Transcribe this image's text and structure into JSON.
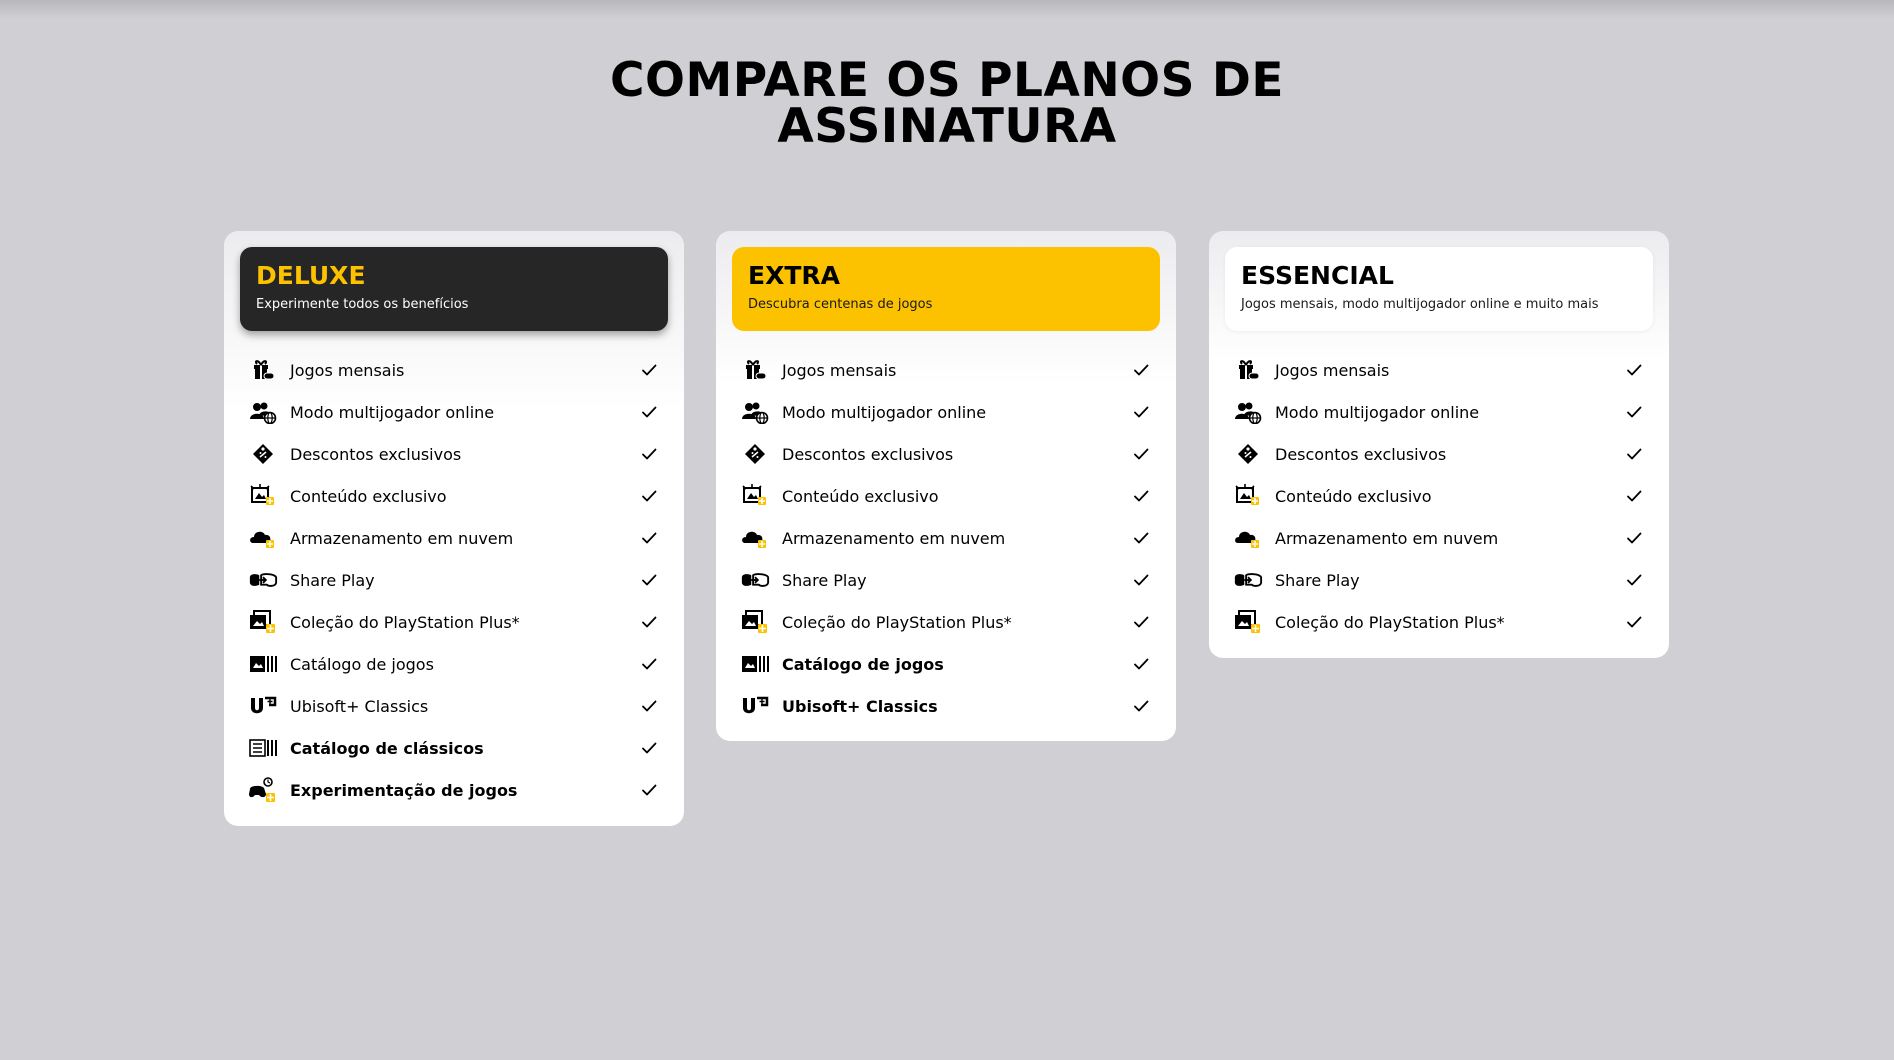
{
  "page": {
    "title_line1": "COMPARE OS PLANOS DE",
    "title_line2": "ASSINATURA"
  },
  "colors": {
    "background": "#cfcfd4",
    "accent_yellow": "#fcc200",
    "deluxe_header": "#262626"
  },
  "plans": [
    {
      "name": "DELUXE",
      "subtitle": "Experimente todos os benefícios",
      "features": [
        {
          "label": "Jogos mensais",
          "icon": "gift-controller-icon",
          "highlight": false,
          "included": true
        },
        {
          "label": "Modo multijogador online",
          "icon": "multiplayer-globe-icon",
          "highlight": false,
          "included": true
        },
        {
          "label": "Descontos exclusivos",
          "icon": "discount-tag-icon",
          "highlight": false,
          "included": true
        },
        {
          "label": "Conteúdo exclusivo",
          "icon": "exclusive-content-icon",
          "highlight": false,
          "included": true
        },
        {
          "label": "Armazenamento em nuvem",
          "icon": "cloud-storage-icon",
          "highlight": false,
          "included": true
        },
        {
          "label": "Share Play",
          "icon": "share-play-icon",
          "highlight": false,
          "included": true
        },
        {
          "label": "Coleção do PlayStation Plus*",
          "icon": "collection-icon",
          "highlight": false,
          "included": true
        },
        {
          "label": "Catálogo de jogos",
          "icon": "game-catalog-icon",
          "highlight": false,
          "included": true
        },
        {
          "label": "Ubisoft+ Classics",
          "icon": "ubisoft-plus-icon",
          "highlight": false,
          "included": true
        },
        {
          "label": "Catálogo de clássicos",
          "icon": "classics-catalog-icon",
          "highlight": true,
          "included": true
        },
        {
          "label": "Experimentação de jogos",
          "icon": "game-trial-icon",
          "highlight": true,
          "included": true
        }
      ]
    },
    {
      "name": "EXTRA",
      "subtitle": "Descubra centenas de jogos",
      "features": [
        {
          "label": "Jogos mensais",
          "icon": "gift-controller-icon",
          "highlight": false,
          "included": true
        },
        {
          "label": "Modo multijogador online",
          "icon": "multiplayer-globe-icon",
          "highlight": false,
          "included": true
        },
        {
          "label": "Descontos exclusivos",
          "icon": "discount-tag-icon",
          "highlight": false,
          "included": true
        },
        {
          "label": "Conteúdo exclusivo",
          "icon": "exclusive-content-icon",
          "highlight": false,
          "included": true
        },
        {
          "label": "Armazenamento em nuvem",
          "icon": "cloud-storage-icon",
          "highlight": false,
          "included": true
        },
        {
          "label": "Share Play",
          "icon": "share-play-icon",
          "highlight": false,
          "included": true
        },
        {
          "label": "Coleção do PlayStation Plus*",
          "icon": "collection-icon",
          "highlight": false,
          "included": true
        },
        {
          "label": "Catálogo de jogos",
          "icon": "game-catalog-icon",
          "highlight": true,
          "included": true
        },
        {
          "label": "Ubisoft+ Classics",
          "icon": "ubisoft-plus-icon",
          "highlight": true,
          "included": true
        }
      ]
    },
    {
      "name": "ESSENCIAL",
      "subtitle": "Jogos mensais, modo multijogador online e muito mais",
      "features": [
        {
          "label": "Jogos mensais",
          "icon": "gift-controller-icon",
          "highlight": false,
          "included": true
        },
        {
          "label": "Modo multijogador online",
          "icon": "multiplayer-globe-icon",
          "highlight": false,
          "included": true
        },
        {
          "label": "Descontos exclusivos",
          "icon": "discount-tag-icon",
          "highlight": false,
          "included": true
        },
        {
          "label": "Conteúdo exclusivo",
          "icon": "exclusive-content-icon",
          "highlight": false,
          "included": true
        },
        {
          "label": "Armazenamento em nuvem",
          "icon": "cloud-storage-icon",
          "highlight": false,
          "included": true
        },
        {
          "label": "Share Play",
          "icon": "share-play-icon",
          "highlight": false,
          "included": true
        },
        {
          "label": "Coleção do PlayStation Plus*",
          "icon": "collection-icon",
          "highlight": false,
          "included": true
        }
      ]
    }
  ]
}
